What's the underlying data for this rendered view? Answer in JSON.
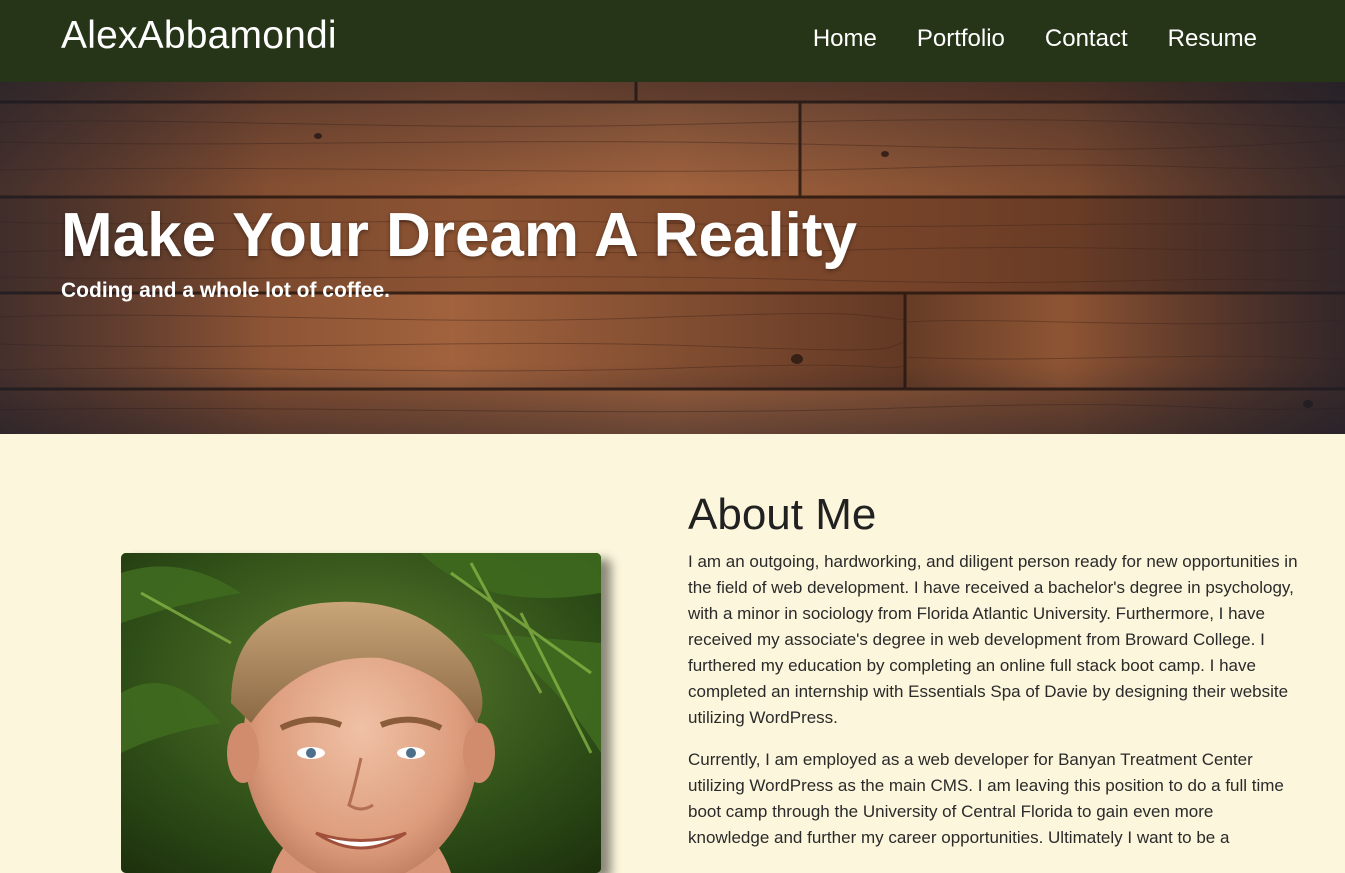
{
  "navbar": {
    "brand": "AlexAbbamondi",
    "links": [
      {
        "label": "Home"
      },
      {
        "label": "Portfolio"
      },
      {
        "label": "Contact"
      },
      {
        "label": "Resume"
      }
    ]
  },
  "hero": {
    "title": "Make Your Dream A Reality",
    "subtitle": "Coding and a whole lot of coffee."
  },
  "about": {
    "heading": "About Me",
    "paragraphs": [
      "I am an outgoing, hardworking, and diligent person ready for new opportunities in the field of web development. I have received a bachelor's degree in psychology, with a minor in sociology from Florida Atlantic University. Furthermore, I have received my associate's degree in web development from Broward College. I furthered my education by completing an online full stack boot camp. I have completed an internship with Essentials Spa of Davie by designing their website utilizing WordPress.",
      "Currently, I am employed as a web developer for Banyan Treatment Center utilizing WordPress as the main CMS. I am leaving this position to do a full time boot camp through the University of Central Florida to gain even more knowledge and further my career opportunities. Ultimately I want to be a"
    ]
  },
  "colors": {
    "navbar_bg": "#263518",
    "page_bg": "#fcf6dc",
    "hero_wood": "#8a4f2c"
  }
}
